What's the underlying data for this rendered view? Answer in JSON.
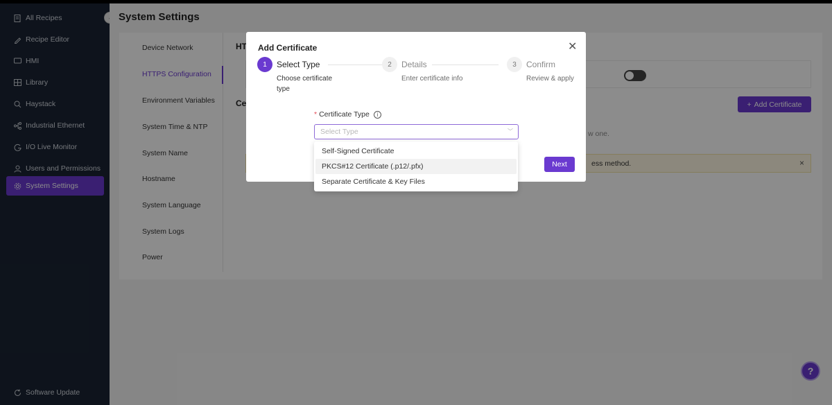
{
  "sidebar": {
    "items": [
      {
        "label": "All Recipes",
        "icon": "document-icon"
      },
      {
        "label": "Recipe Editor",
        "icon": "pencil-icon"
      },
      {
        "label": "HMI",
        "icon": "monitor-icon"
      },
      {
        "label": "Library",
        "icon": "grid-icon"
      },
      {
        "label": "Haystack",
        "icon": "search-icon"
      },
      {
        "label": "Industrial Ethernet",
        "icon": "network-icon"
      },
      {
        "label": "I/O Live Monitor",
        "icon": "gauge-icon"
      },
      {
        "label": "Users and Permissions",
        "icon": "user-icon"
      },
      {
        "label": "System Settings",
        "icon": "gear-icon"
      }
    ],
    "footer": {
      "label": "Software Update",
      "icon": "refresh-icon"
    }
  },
  "page": {
    "title": "System Settings"
  },
  "subnav": {
    "items": [
      "Device Network",
      "HTTPS Configuration",
      "Environment Variables",
      "System Time & NTP",
      "System Name",
      "Hostname",
      "System Language",
      "System Logs",
      "Power"
    ]
  },
  "background": {
    "section_heading_partial": "HT",
    "cert_heading_partial": "Ce",
    "add_certificate_label": "Add Certificate",
    "empty_text_partial": "w one.",
    "alert_text_partial": "ess method."
  },
  "modal": {
    "title": "Add Certificate",
    "steps": [
      {
        "num": "1",
        "label": "Select Type",
        "desc": "Choose certificate type"
      },
      {
        "num": "2",
        "label": "Details",
        "desc": "Enter certificate info"
      },
      {
        "num": "3",
        "label": "Confirm",
        "desc": "Review & apply"
      }
    ],
    "field_label": "Certificate Type",
    "field_required": "*",
    "select_placeholder": "Select Type",
    "next_label": "Next",
    "options": [
      "Self-Signed Certificate",
      "PKCS#12 Certificate (.p12/.pfx)",
      "Separate Certificate & Key Files"
    ]
  },
  "colors": {
    "accent": "#6a3ad0",
    "sidebar_bg": "#1a2433"
  }
}
